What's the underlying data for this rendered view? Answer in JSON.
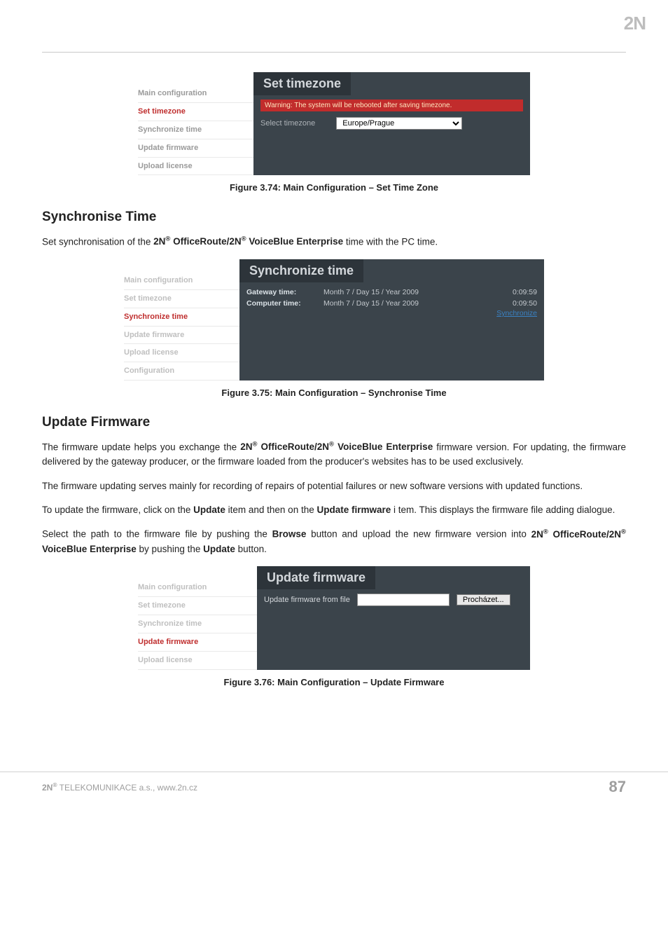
{
  "logo": "2N",
  "fig1": {
    "nav": [
      "Main configuration",
      "Set timezone",
      "Synchronize time",
      "Update firmware",
      "Upload license"
    ],
    "title": "Set timezone",
    "warning": "Warning: The system will be rebooted after saving timezone.",
    "select_label": "Select timezone",
    "select_value": "Europe/Prague",
    "caption": "Figure 3.74: Main Configuration – Set Time Zone"
  },
  "sync": {
    "heading": "Synchronise Time",
    "para_a": "Set synchronisation of the ",
    "para_b": " OfficeRoute/2N",
    "para_c": " VoiceBlue Enterprise",
    "para_d": " time with the PC time."
  },
  "fig2": {
    "nav": [
      "Main configuration",
      "Set timezone",
      "Synchronize time",
      "Update firmware",
      "Upload license",
      "Configuration"
    ],
    "title": "Synchronize time",
    "row1_k": "Gateway time:",
    "row1_v": "Month 7 / Day 15 / Year 2009",
    "row1_t": "0:09:59",
    "row2_k": "Computer time:",
    "row2_v": "Month 7 / Day 15 / Year 2009",
    "row2_t": "0:09:50",
    "link": "Synchronize",
    "caption": "Figure 3.75: Main Configuration – Synchronise Time"
  },
  "upd": {
    "heading": "Update Firmware",
    "p1a": "The firmware update helps you exchange the ",
    "p1b": " OfficeRoute/2N",
    "p1c": " VoiceBlue Enterprise",
    "p1d": " firmware version. For updating, the firmware delivered by the gateway producer, or the firmware loaded from the producer's websites has to be used exclusively.",
    "p2": "The firmware updating serves mainly for recording of repairs of potential failures or new software versions with updated functions.",
    "p3a": "To update the firmware, click on the ",
    "p3b": "Update",
    "p3c": " item and then on the ",
    "p3d": "Update firmware",
    "p3e": " i tem. This displays the firmware file adding dialogue.",
    "p4a": "Select the path to the firmware file by pushing the ",
    "p4b": "Browse",
    "p4c": " button and upload the new firmware version into ",
    "p4d": " OfficeRoute/2N",
    "p4e": " VoiceBlue Enterprise",
    "p4f": " by pushing the ",
    "p4g": "Update",
    "p4h": " button."
  },
  "fig3": {
    "nav": [
      "Main configuration",
      "Set timezone",
      "Synchronize time",
      "Update firmware",
      "Upload license"
    ],
    "title": "Update firmware",
    "label": "Update firmware from file",
    "browse": "Procházet...",
    "caption": "Figure 3.76: Main Configuration – Update Firmware"
  },
  "footer": {
    "left_a": "2N",
    "left_b": " TELEKOMUNIKACE a.s., www.2n.cz",
    "page": "87"
  }
}
